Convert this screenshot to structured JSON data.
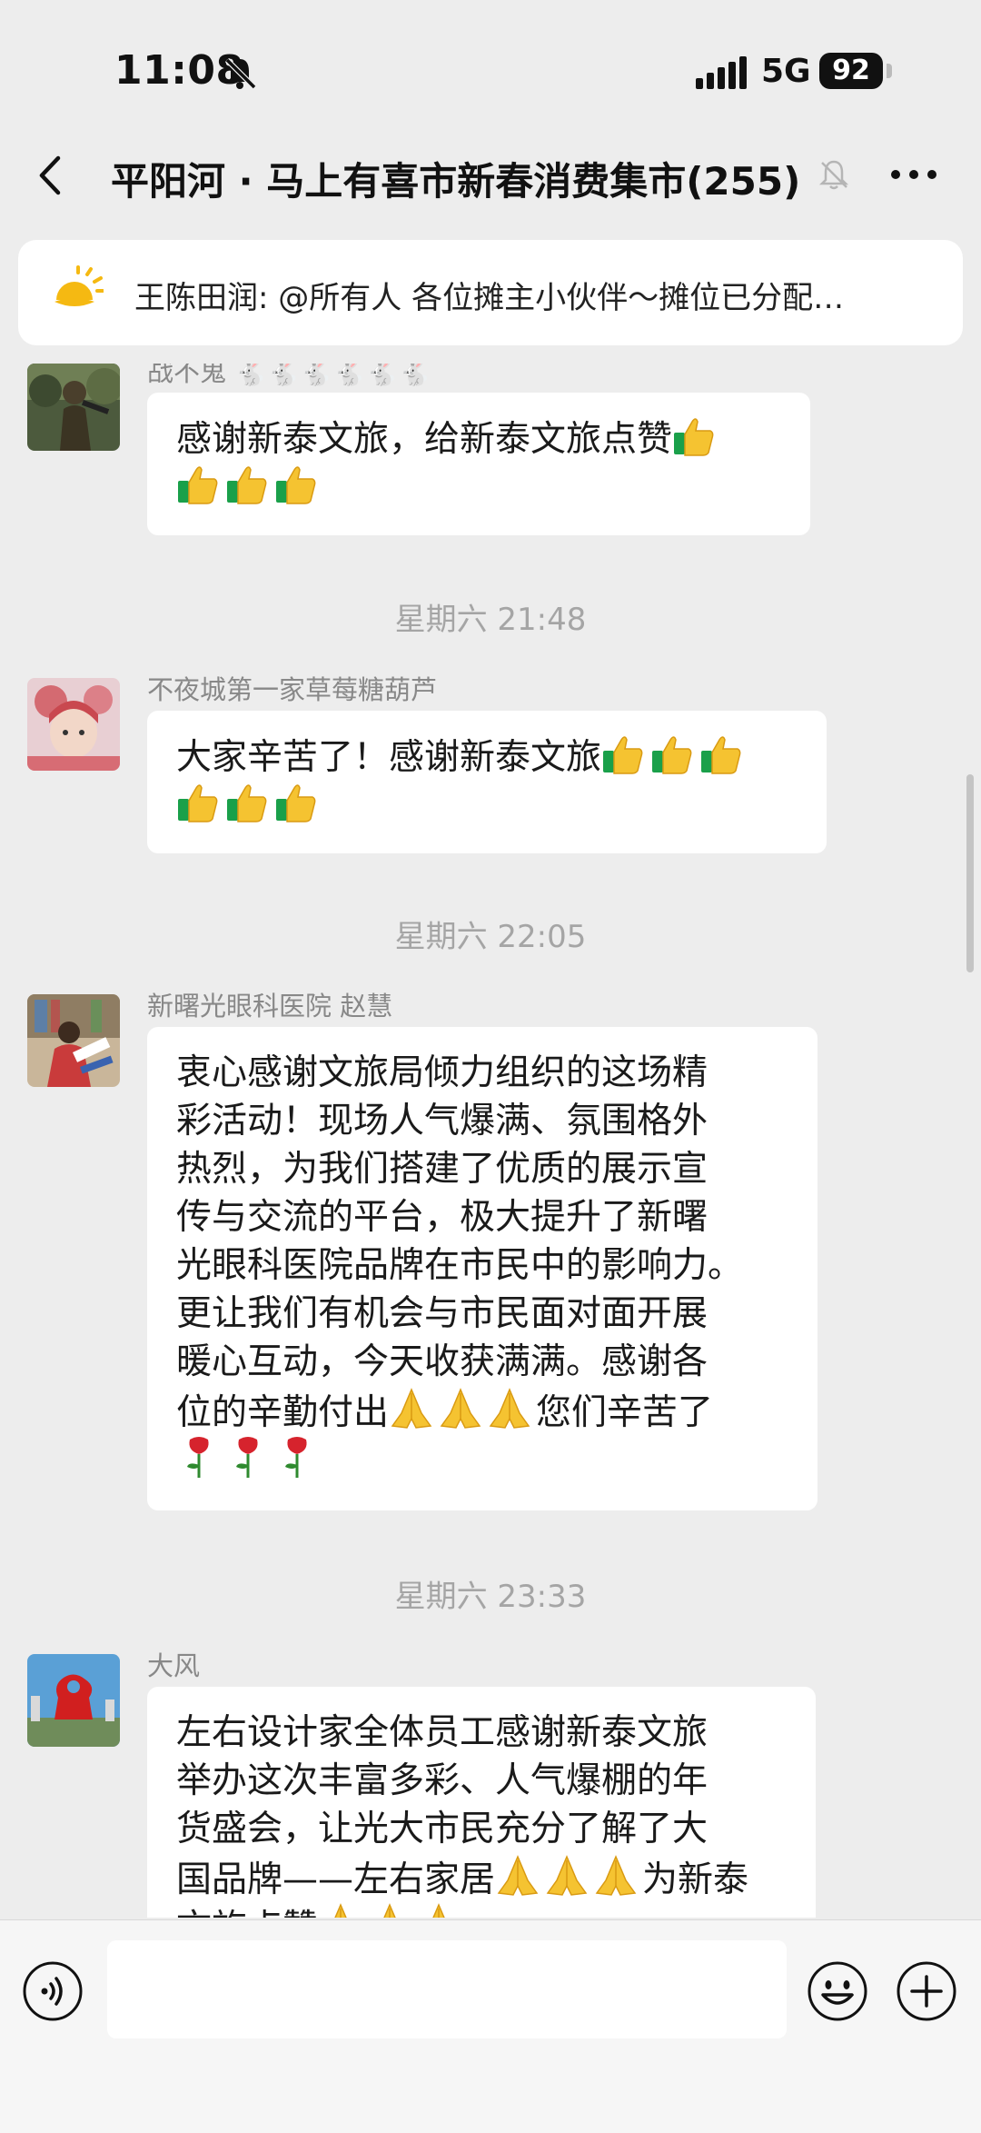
{
  "status_bar": {
    "time": "11:08",
    "network": "5G",
    "battery": "92"
  },
  "header": {
    "title": "平阳河 · 马上有喜市新春消费集市(255)"
  },
  "pinned": {
    "text": "王陈田润: @所有人  各位摊主小伙伴～摊位已分配…"
  },
  "messages": [
    {
      "sender": "战不鬼 🐇🐇🐇🐇🐇🐇",
      "lines": [
        "感谢新泰文旅，给新泰文旅点赞"
      ],
      "emoji_line_2": "thumbs-up x3"
    },
    {
      "timestamp": "星期六 21:48",
      "sender": "不夜城第一家草莓糖葫芦",
      "lines": [
        "大家辛苦了！感谢新泰文旅"
      ]
    },
    {
      "timestamp": "星期六 22:05",
      "sender": "新曙光眼科医院 赵慧",
      "lines": [
        "衷心感谢文旅局倾力组织的这场精",
        "彩活动！现场人气爆满、氛围格外",
        "热烈，为我们搭建了优质的展示宣",
        "传与交流的平台，极大提升了新曙",
        "光眼科医院品牌在市民中的影响力。",
        "更让我们有机会与市民面对面开展",
        "暖心互动，今天收获满满。感谢各",
        "位的辛勤付出",
        "您们辛苦了"
      ]
    },
    {
      "timestamp": "星期六 23:33",
      "sender": "大风",
      "lines": [
        "左右设计家全体员工感谢新泰文旅",
        "举办这次丰富多彩、人气爆棚的年",
        "货盛会，让光大市民充分了解了大",
        "国品牌——左右家居",
        "为新泰",
        "文旅点赞"
      ]
    }
  ],
  "icons": {
    "back": "chevron-left-icon",
    "mute": "bell-slash-icon",
    "more": "more-dots-icon",
    "pinned": "sun-icon",
    "voice": "voice-icon",
    "emoji": "emoji-icon",
    "plus": "plus-icon"
  },
  "colors": {
    "background": "#ededed",
    "bubble": "#ffffff",
    "thumb": "#f5c331",
    "cuff": "#1aa04a",
    "rose": "#d6232d"
  }
}
